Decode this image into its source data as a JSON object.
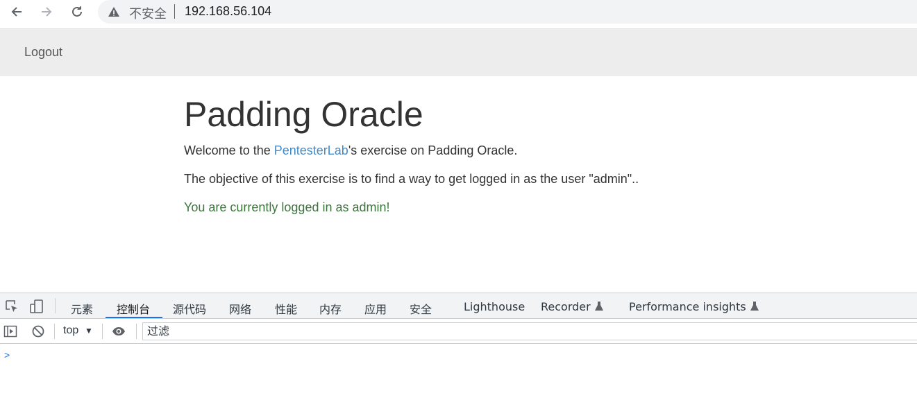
{
  "browser": {
    "security_label": "不安全",
    "url": "192.168.56.104"
  },
  "navbar": {
    "logout_label": "Logout"
  },
  "page": {
    "title": "Padding Oracle",
    "welcome_prefix": "Welcome to the ",
    "welcome_link": "PentesterLab",
    "welcome_suffix": "'s exercise on Padding Oracle.",
    "objective": "The objective of this exercise is to find a way to get logged in as the user \"admin\"..",
    "status": "You are currently logged in as admin!"
  },
  "devtools": {
    "tabs": [
      {
        "label": "元素"
      },
      {
        "label": "控制台",
        "active": true
      },
      {
        "label": "源代码"
      },
      {
        "label": "网络"
      },
      {
        "label": "性能"
      },
      {
        "label": "内存"
      },
      {
        "label": "应用"
      },
      {
        "label": "安全"
      },
      {
        "label": "Lighthouse"
      },
      {
        "label": "Recorder"
      },
      {
        "label": "Performance insights"
      }
    ],
    "context": "top",
    "filter_placeholder": "过滤",
    "prompt_symbol": ">"
  },
  "colors": {
    "link": "#428bca",
    "success": "#3c763d",
    "active_tab": "#1a73e8"
  }
}
